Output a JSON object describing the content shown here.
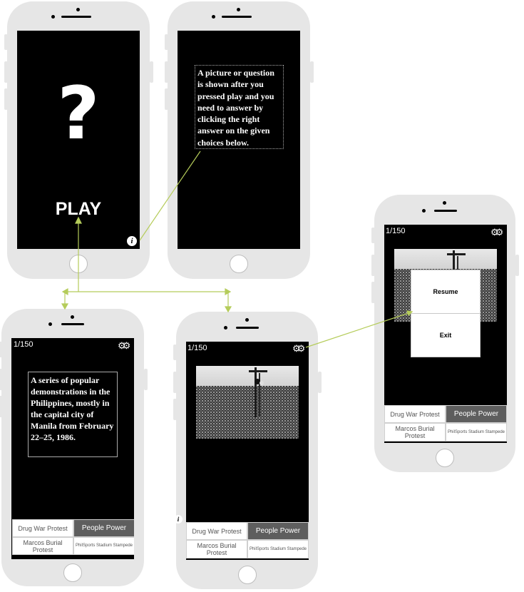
{
  "splash": {
    "question_mark": "?",
    "play_label": "PLAY",
    "info_icon_glyph": "i"
  },
  "instructions": {
    "text": "A picture or question is shown after you pressed play and you need to answer by clicking the right answer on the given choices below."
  },
  "text_question": {
    "counter": "1/150",
    "question": "A series of popular demonstrations in the Philippines, mostly in the capital city of Manila from February 22–25, 1986.",
    "choices": [
      "Drug War Protest",
      "People Power",
      "Marcos Burial Protest",
      "PhilSports Stadium Stampede"
    ],
    "selected_choice": "People Power"
  },
  "picture_question": {
    "counter": "1/150",
    "info_icon_glyph": "i",
    "choices": [
      "Drug War Protest",
      "People Power",
      "Marcos Burial Protest",
      "PhilSports Stadium Stampede"
    ],
    "selected_choice": "People Power"
  },
  "pause_menu": {
    "counter": "1/150",
    "resume_label": "Resume",
    "exit_label": "Exit",
    "choices": [
      "Drug War Protest",
      "People Power",
      "Marcos Burial Protest",
      "PhilSports Stadium Stampede"
    ],
    "selected_choice": "People Power"
  },
  "icons": {
    "settings": "gears-icon",
    "info": "info-icon"
  },
  "colors": {
    "phone_body": "#e6e6e6",
    "screen": "#000000",
    "connector": "#b5cc5a",
    "selected_choice": "#5e5e5e"
  }
}
